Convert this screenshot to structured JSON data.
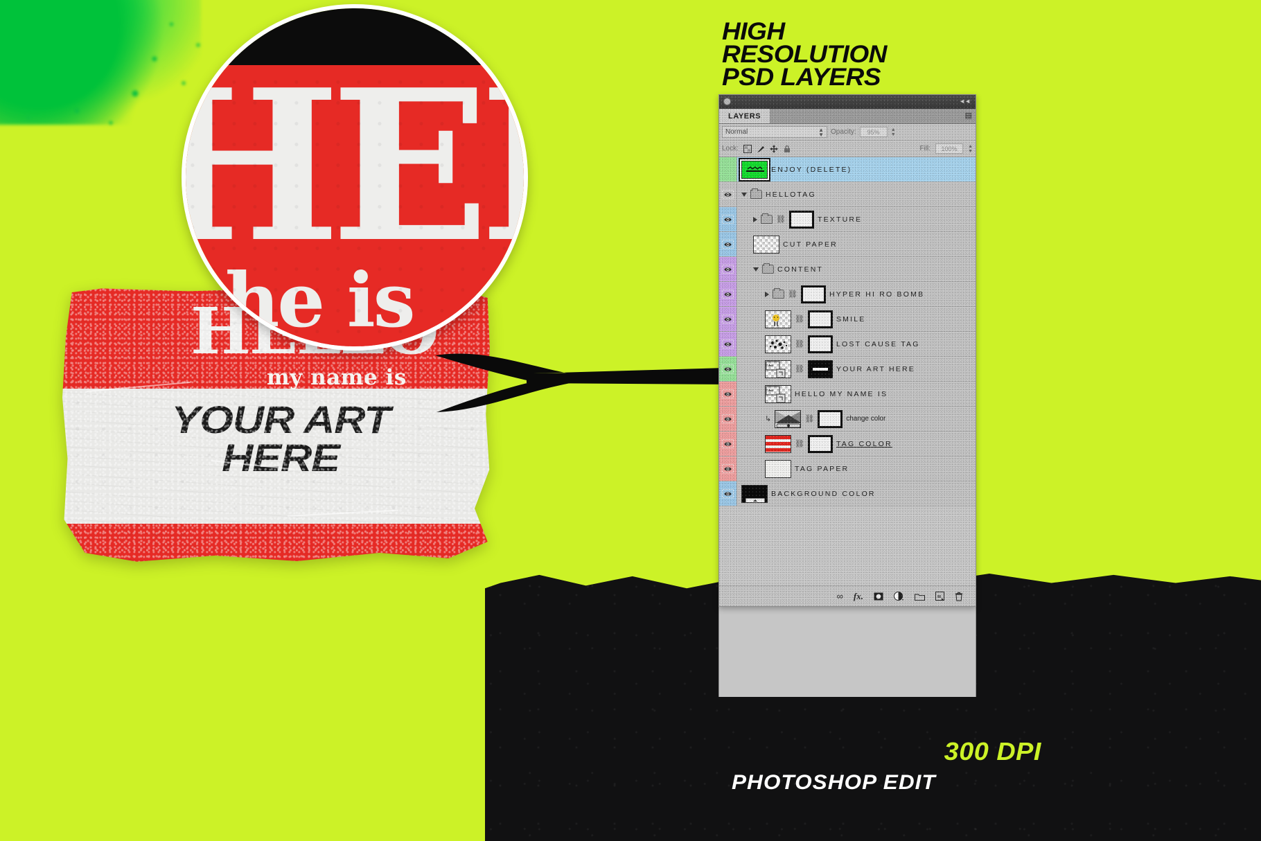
{
  "theme": {
    "background": "#ccf227",
    "sticker_red": "#e62a25",
    "sticker_paper": "#e9e9e7",
    "black": "#111112",
    "accent_green_spray": "#00c23a",
    "panel_gray": "#c6c6c6",
    "selected_blue": "#a8d4ee"
  },
  "headline": {
    "line1": "HIGH",
    "line2": "RESOLUTION",
    "line3": "PSD LAYERS"
  },
  "captions": {
    "dpi": "300 DPI",
    "edit": "PHOTOSHOP EDIT"
  },
  "sticker": {
    "hello": "HELLO",
    "my_name_is": "my name is",
    "art_line1": "YOUR ART",
    "art_line2": "HERE"
  },
  "zoom_circle": {
    "hello": "HELLO",
    "line2": "the is"
  },
  "panel": {
    "tab_label": "LAYERS",
    "blend_mode": "Normal",
    "opacity_label": "Opacity:",
    "opacity_value": "95%",
    "lock_label": "Lock:",
    "fill_label": "Fill:",
    "fill_value": "100%",
    "lock_icons": [
      "transparency-lock-icon",
      "brush-lock-icon",
      "move-lock-icon",
      "all-lock-icon"
    ],
    "footer_icons": [
      "link-layers-icon",
      "layer-style-fx-icon",
      "add-mask-icon",
      "adjustment-layer-icon",
      "new-group-icon",
      "new-layer-icon",
      "delete-layer-icon"
    ],
    "layers": [
      {
        "name": "ENJOY (DELETE)",
        "color": "green",
        "type": "layer",
        "selected": true,
        "visible": false,
        "thumb": "green-art",
        "indent": 0,
        "has_mask": false
      },
      {
        "name": "HELLOTAG",
        "color": "none",
        "type": "group",
        "selected": false,
        "visible": true,
        "expanded": true,
        "indent": 0,
        "has_mask": false
      },
      {
        "name": "TEXTURE",
        "color": "blue",
        "type": "group",
        "selected": false,
        "visible": true,
        "expanded": false,
        "indent": 1,
        "has_mask": true
      },
      {
        "name": "CUT PAPER",
        "color": "blue",
        "type": "layer",
        "selected": false,
        "visible": true,
        "thumb": "checker",
        "indent": 1,
        "has_mask": false
      },
      {
        "name": "CONTENT",
        "color": "purple",
        "type": "group",
        "selected": false,
        "visible": true,
        "expanded": true,
        "indent": 1,
        "has_mask": false
      },
      {
        "name": "HYPER HI RO BOMB",
        "color": "purple",
        "type": "group",
        "selected": false,
        "visible": true,
        "expanded": false,
        "indent": 2,
        "has_mask": true
      },
      {
        "name": "SMILE",
        "color": "purple",
        "type": "layer",
        "selected": false,
        "visible": true,
        "thumb": "smile",
        "indent": 2,
        "has_mask": true
      },
      {
        "name": "LOST CAUSE TAG",
        "color": "purple",
        "type": "layer",
        "selected": false,
        "visible": true,
        "thumb": "splatter",
        "indent": 2,
        "has_mask": true
      },
      {
        "name": "YOUR ART HERE",
        "color": "green",
        "type": "layer",
        "selected": false,
        "visible": true,
        "thumb": "smart-object",
        "indent": 2,
        "has_mask": true,
        "mask_style": "black"
      },
      {
        "name": "HELLO MY NAME IS",
        "color": "red",
        "type": "layer",
        "selected": false,
        "visible": true,
        "thumb": "smart-object",
        "indent": 2,
        "has_mask": false
      },
      {
        "name": "change color",
        "color": "red",
        "type": "adjustment",
        "selected": false,
        "visible": true,
        "thumb": "gradient-map",
        "indent": 2,
        "has_mask": true,
        "clipped": true
      },
      {
        "name": "TAG COLOR",
        "color": "red",
        "type": "layer",
        "selected": false,
        "visible": true,
        "thumb": "stripes",
        "indent": 2,
        "has_mask": true,
        "underline": true
      },
      {
        "name": "TAG PAPER",
        "color": "red",
        "type": "layer",
        "selected": false,
        "visible": true,
        "thumb": "paper",
        "indent": 2,
        "has_mask": false
      },
      {
        "name": "BACKGROUND COLOR",
        "color": "blue",
        "type": "layer",
        "selected": false,
        "visible": true,
        "thumb": "black-swatch",
        "indent": 0,
        "has_mask": false
      }
    ]
  }
}
